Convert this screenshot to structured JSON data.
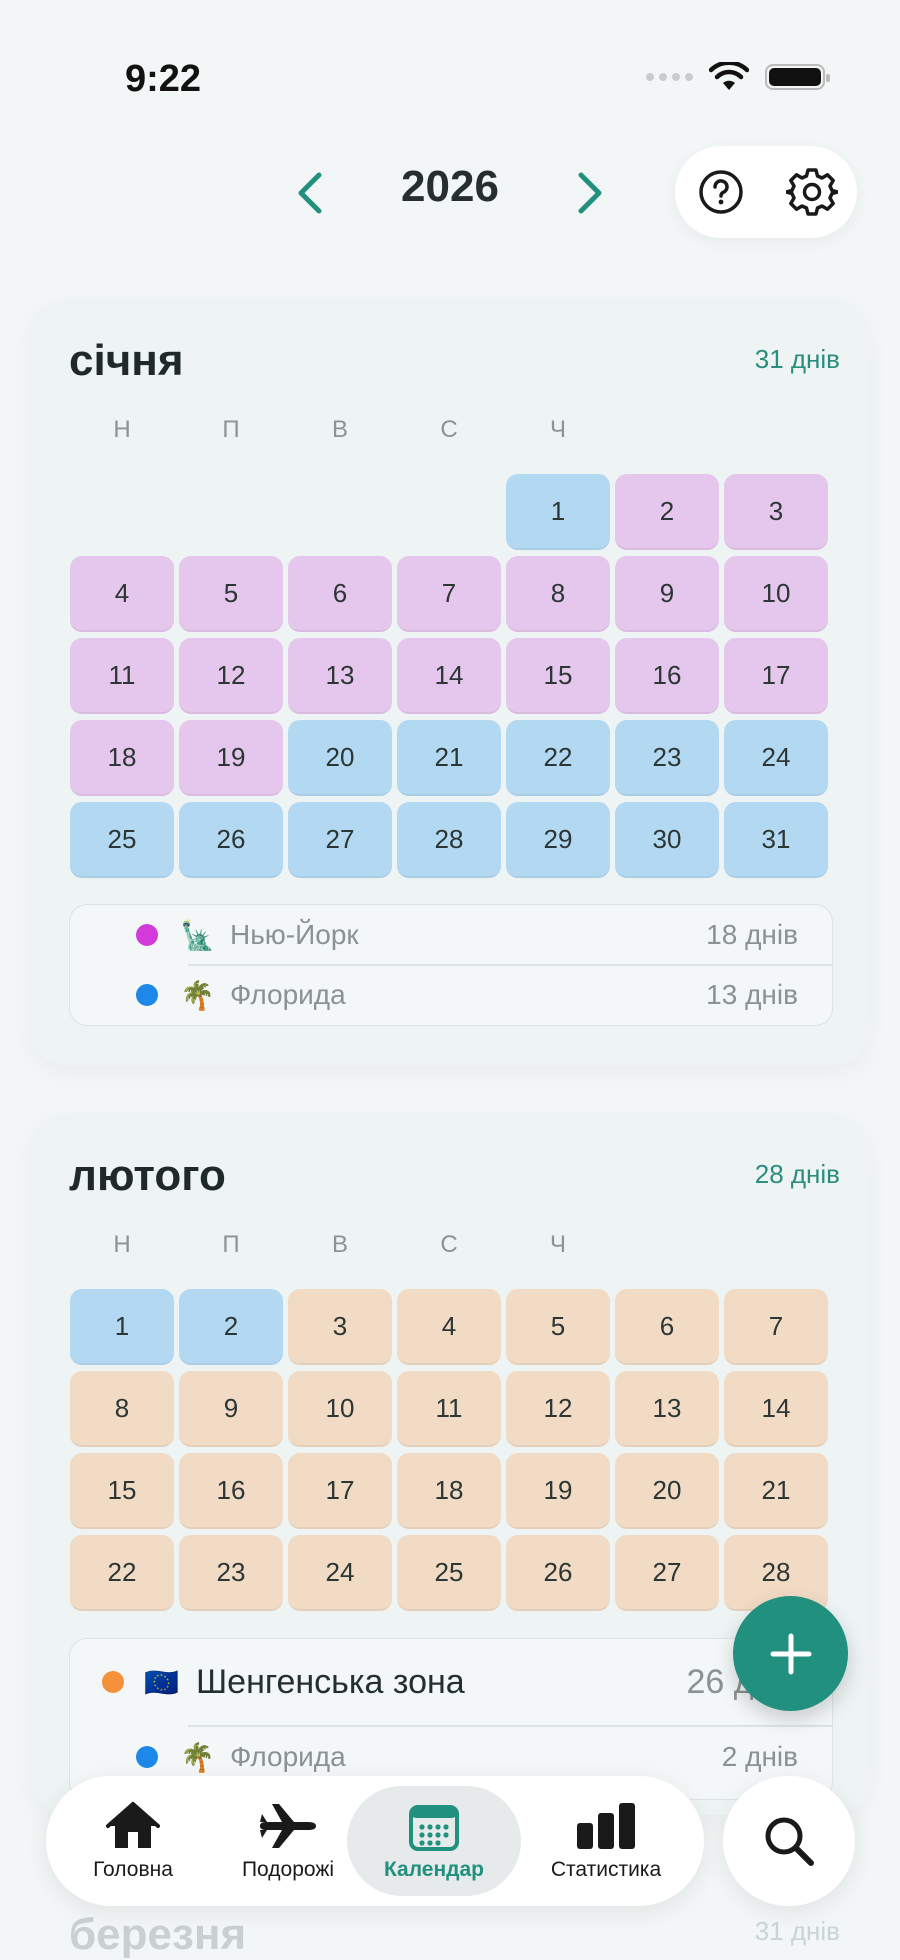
{
  "status_bar": {
    "time": "9:22"
  },
  "header": {
    "year": "2026",
    "prev_icon": "chevron-left-icon",
    "next_icon": "chevron-right-icon",
    "help_icon": "question-circle-icon",
    "settings_icon": "gear-icon"
  },
  "colors": {
    "accent": "#22907e",
    "pink": "#e5c6ec",
    "blue": "#b3d8f2",
    "peach": "#f1dbc4",
    "dot_purple": "#d23bd9",
    "dot_blue": "#1e88e8",
    "dot_orange": "#f5913a"
  },
  "weekdays": [
    "Н",
    "П",
    "В",
    "С",
    "Ч"
  ],
  "months": [
    {
      "title": "січня",
      "days_label": "31 днів",
      "legend": [
        {
          "emoji": "🗽",
          "name": "Нью-Йорк",
          "days": "18 днів"
        },
        {
          "emoji": "🌴",
          "name": "Флорида",
          "days": "13 днів"
        }
      ]
    },
    {
      "title": "лютого",
      "days_label": "28 днів",
      "legend": [
        {
          "emoji": "🇪🇺",
          "name": "Шенгенська зона",
          "days": "26 днів"
        },
        {
          "emoji": "🌴",
          "name": "Флорида",
          "days": "2 днів"
        }
      ]
    },
    {
      "title": "березня",
      "days_label": "31 днів"
    }
  ],
  "tabs": [
    {
      "label": "Головна",
      "icon": "home-icon"
    },
    {
      "label": "Подорожі",
      "icon": "airplane-icon"
    },
    {
      "label": "Календар",
      "icon": "calendar-icon"
    },
    {
      "label": "Статистика",
      "icon": "bar-chart-icon"
    }
  ],
  "fab": {
    "icon": "plus-icon"
  },
  "search": {
    "icon": "search-icon"
  }
}
